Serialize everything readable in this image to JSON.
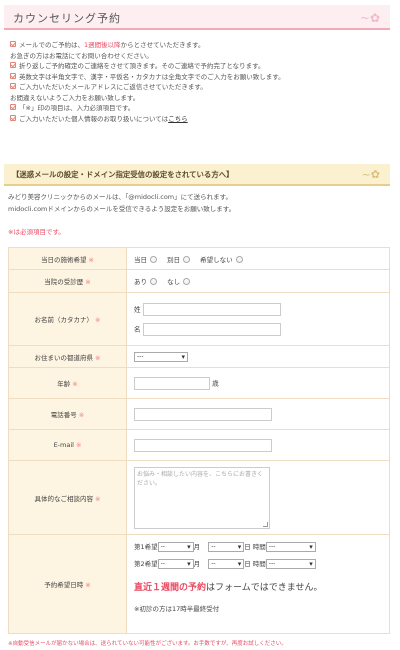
{
  "header": {
    "title": "カウンセリング予約",
    "deco": "~✿"
  },
  "notice": {
    "l1a": "メールでのご予約は、",
    "l1b": "1週間後以降",
    "l1c": "からとさせていただきます。",
    "l2": "お急ぎの方はお電話にてお問い合わせください。",
    "l3": "折り返しご予約確定のご連絡をさせて頂きます。そのご連絡で予約完了となります。",
    "l4": "英数文字は半角文字で、漢字・平仮名・カタカナは全角文字でのご入力をお願い致します。",
    "l5": "ご入力いただいたメールアドレスにご返信させていただきます。",
    "l6": "お間違えないようご入力をお願い致します。",
    "l7": "「※」印の項目は、入力必須項目です。",
    "l8a": "ご入力いただいた個人情報のお取り扱いについては",
    "l8b": "こちら"
  },
  "section2": {
    "title": "【迷惑メールの設定・ドメイン指定受信の設定をされている方へ】",
    "deco": "~✿"
  },
  "info": {
    "l1": "みどり美容クリニックからのメールは、「@midocli.com」にて送られます。",
    "l2": "midocli.comドメインからのメールを受信できるよう設定をお願い致します。"
  },
  "required_note": "※は必須項目です。",
  "req_mark": "※",
  "form": {
    "same_day": {
      "label": "当日の施術希望",
      "opt1": "当日",
      "opt2": "別日",
      "opt3": "希望しない"
    },
    "visited": {
      "label": "当院の受診歴",
      "opt1": "あり",
      "opt2": "なし"
    },
    "name": {
      "label": "お名前（カタカナ）",
      "sei": "姓",
      "mei": "名"
    },
    "prefecture": {
      "label": "お住まいの都道府県",
      "value": "---"
    },
    "age": {
      "label": "年齢",
      "unit": "歳"
    },
    "phone": {
      "label": "電話番号"
    },
    "email": {
      "label": "E-mail"
    },
    "consult": {
      "label": "具体的なご相談内容",
      "placeholder": "お悩み・相談したい内容を、こちらにお書きください。"
    },
    "datetime": {
      "label": "予約希望日時",
      "first": "第1希望",
      "second": "第2希望",
      "blank": "--",
      "month": "月",
      "day": "日",
      "time": "時間",
      "time_value": "---",
      "warn_red": "直近１週間の予約",
      "warn_black": "はフォームではできません。",
      "note": "※初診の方は17時半最終受付"
    }
  },
  "footnote": "※自動受信メールが届かない場合は、送られていない可能性がございます。お手数ですが、再度お試しください。"
}
